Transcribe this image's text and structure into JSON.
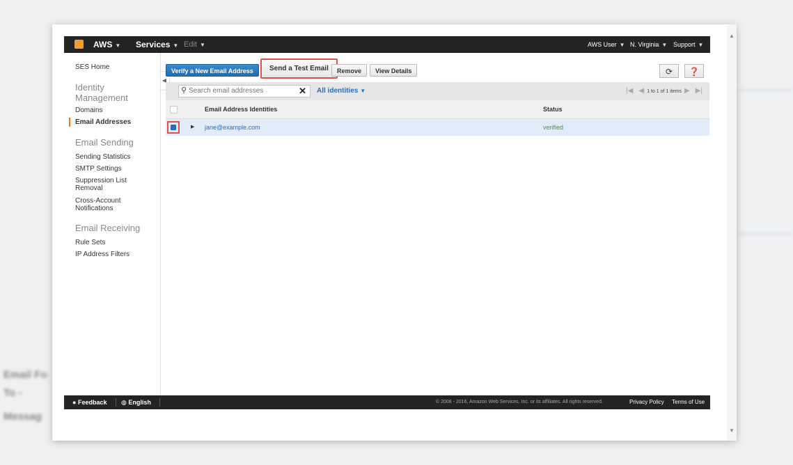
{
  "nav": {
    "aws": "AWS",
    "services": "Services",
    "edit": "Edit",
    "user": "AWS User",
    "region": "N. Virginia",
    "support": "Support"
  },
  "sidebar": {
    "ses_home": "SES Home",
    "identity_heading": "Identity Management",
    "domains": "Domains",
    "email_addresses": "Email Addresses",
    "sending_heading": "Email Sending",
    "sending_statistics": "Sending Statistics",
    "smtp_settings": "SMTP Settings",
    "suppression": "Suppression List Removal",
    "cross_account": "Cross-Account Notifications",
    "receiving_heading": "Email Receiving",
    "rule_sets": "Rule Sets",
    "ip_filters": "IP Address Filters"
  },
  "toolbar": {
    "verify": "Verify a New Email Address",
    "send_test": "Send a Test Email",
    "remove": "Remove",
    "view_details": "View Details"
  },
  "filter": {
    "search_placeholder": "Search email addresses",
    "all_identities": "All identities",
    "pager": "1 to 1 of 1 items"
  },
  "table": {
    "col_identity": "Email Address Identities",
    "col_status": "Status",
    "rows": [
      {
        "email": "jane@example.com",
        "status": "verified"
      }
    ]
  },
  "footer": {
    "feedback": "Feedback",
    "language": "English",
    "copyright": "© 2008 - 2016, Amazon Web Services, Inc. or its affiliates. All rights reserved.",
    "privacy": "Privacy Policy",
    "terms": "Terms of Use"
  },
  "colors": {
    "nav_bg": "#232323",
    "primary_button": "#1f6bb4",
    "highlight": "#d9534f",
    "status_ok": "#3c9e3c",
    "accent": "#e47911"
  }
}
